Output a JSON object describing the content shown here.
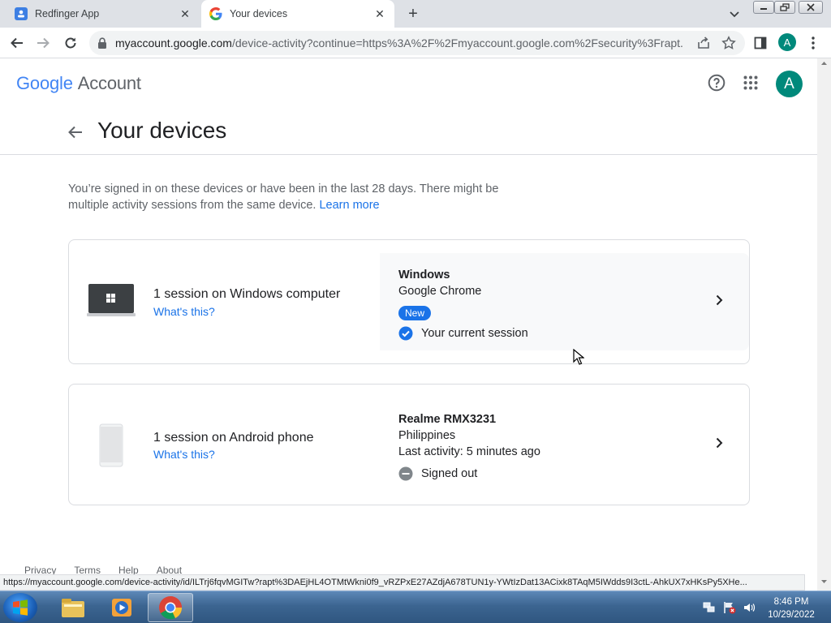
{
  "browser": {
    "tabs": [
      {
        "title": "Redfinger App",
        "active": false
      },
      {
        "title": "Your devices",
        "active": true
      }
    ],
    "address": {
      "host": "myaccount.google.com",
      "path": "/device-activity?continue=https%3A%2F%2Fmyaccount.google.com%2Fsecurity%3Frapt..."
    },
    "profile_initial": "A"
  },
  "page": {
    "logo_google": "Google",
    "logo_account": "Account",
    "avatar_initial": "A",
    "title": "Your devices",
    "intro_text": "You’re signed in on these devices or have been in the last 28 days. There might be multiple activity sessions from the same device.",
    "learn_more": "Learn more",
    "devices": [
      {
        "heading": "1 session on Windows computer",
        "whats_this": "What's this?",
        "os": "Windows",
        "browser": "Google Chrome",
        "badge": "New",
        "status": "Your current session"
      },
      {
        "heading": "1 session on Android phone",
        "whats_this": "What's this?",
        "model": "Realme RMX3231",
        "location": "Philippines",
        "last_activity": "Last activity: 5 minutes ago",
        "status": "Signed out"
      }
    ],
    "footer": [
      "Privacy",
      "Terms",
      "Help",
      "About"
    ]
  },
  "status_url": "https://myaccount.google.com/device-activity/id/ILTrj6fqvMGITw?rapt%3DAEjHL4OTMtWkni0f9_vRZPxE27AZdjA678TUN1y-YWtIzDat13ACixk8TAqM5IWdds9I3ctL-AhkUX7xHKsPy5XHe...",
  "taskbar": {
    "time": "8:46 PM",
    "date": "10/29/2022"
  },
  "colors": {
    "accent": "#1a73e8",
    "avatar": "#00897b",
    "tabstrip": "#dee1e6"
  }
}
